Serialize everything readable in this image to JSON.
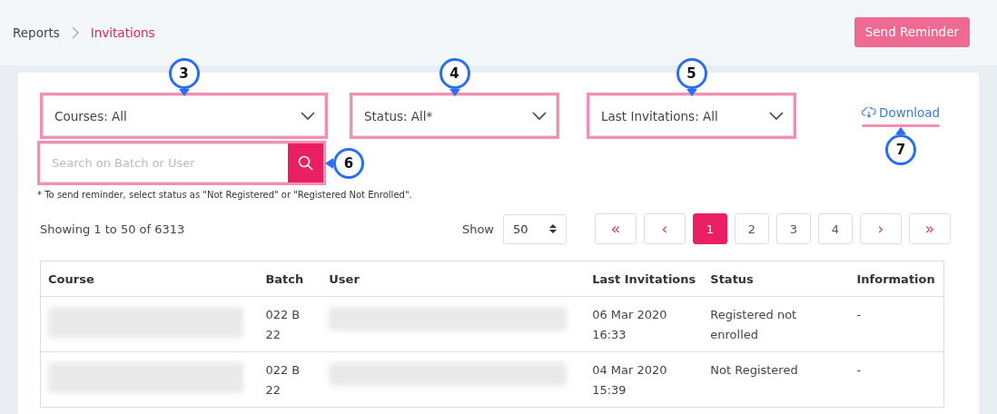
{
  "breadcrumb": {
    "items": [
      {
        "label": "Reports",
        "selected": false
      },
      {
        "label": "Invitations",
        "selected": true
      }
    ]
  },
  "send_button": {
    "label": "Send Reminder"
  },
  "filters": [
    {
      "value": "Courses: All",
      "highlighted": true,
      "callout": {
        "number": "3",
        "kind": "down"
      }
    },
    {
      "value": "Status: All*",
      "highlighted": true,
      "callout": {
        "number": "4",
        "kind": "down"
      }
    },
    {
      "value": "Last Invitations: All",
      "highlighted": true,
      "callout": {
        "number": "5",
        "kind": "down"
      }
    }
  ],
  "download": {
    "label": "Download",
    "highlighted": true,
    "callout": {
      "number": "7",
      "kind": "up"
    }
  },
  "search": {
    "placeholder": "Search on Batch or User",
    "highlighted": true,
    "callout": {
      "number": "6",
      "kind": "left"
    }
  },
  "note": "* To send reminder, select status as \"Not Registered\" or \"Registered Not Enrolled\".",
  "summary": "Showing 1 to 50 of 6313",
  "page_size": {
    "label": "Show",
    "value": "50"
  },
  "pagination": [
    {
      "label": "«",
      "kind": "nav",
      "selected": false
    },
    {
      "label": "‹",
      "kind": "nav",
      "selected": false
    },
    {
      "label": "1",
      "kind": "page",
      "selected": true
    },
    {
      "label": "2",
      "kind": "page",
      "selected": false
    },
    {
      "label": "3",
      "kind": "page",
      "selected": false
    },
    {
      "label": "4",
      "kind": "page",
      "selected": false
    },
    {
      "label": "›",
      "kind": "nav",
      "selected": false
    },
    {
      "label": "»",
      "kind": "nav",
      "selected": false
    }
  ],
  "table": {
    "columns": [
      "Course",
      "Batch",
      "User",
      "Last Invitations",
      "Status",
      "Information"
    ],
    "rows": [
      {
        "batch": "022 B 22",
        "last_invitation": "06 Mar 2020 16:33",
        "status": "Registered not enrolled",
        "information": "-"
      },
      {
        "batch": "022 B 22",
        "last_invitation": "04 Mar 2020 15:39",
        "status": "Not Registered",
        "information": "-"
      }
    ]
  }
}
